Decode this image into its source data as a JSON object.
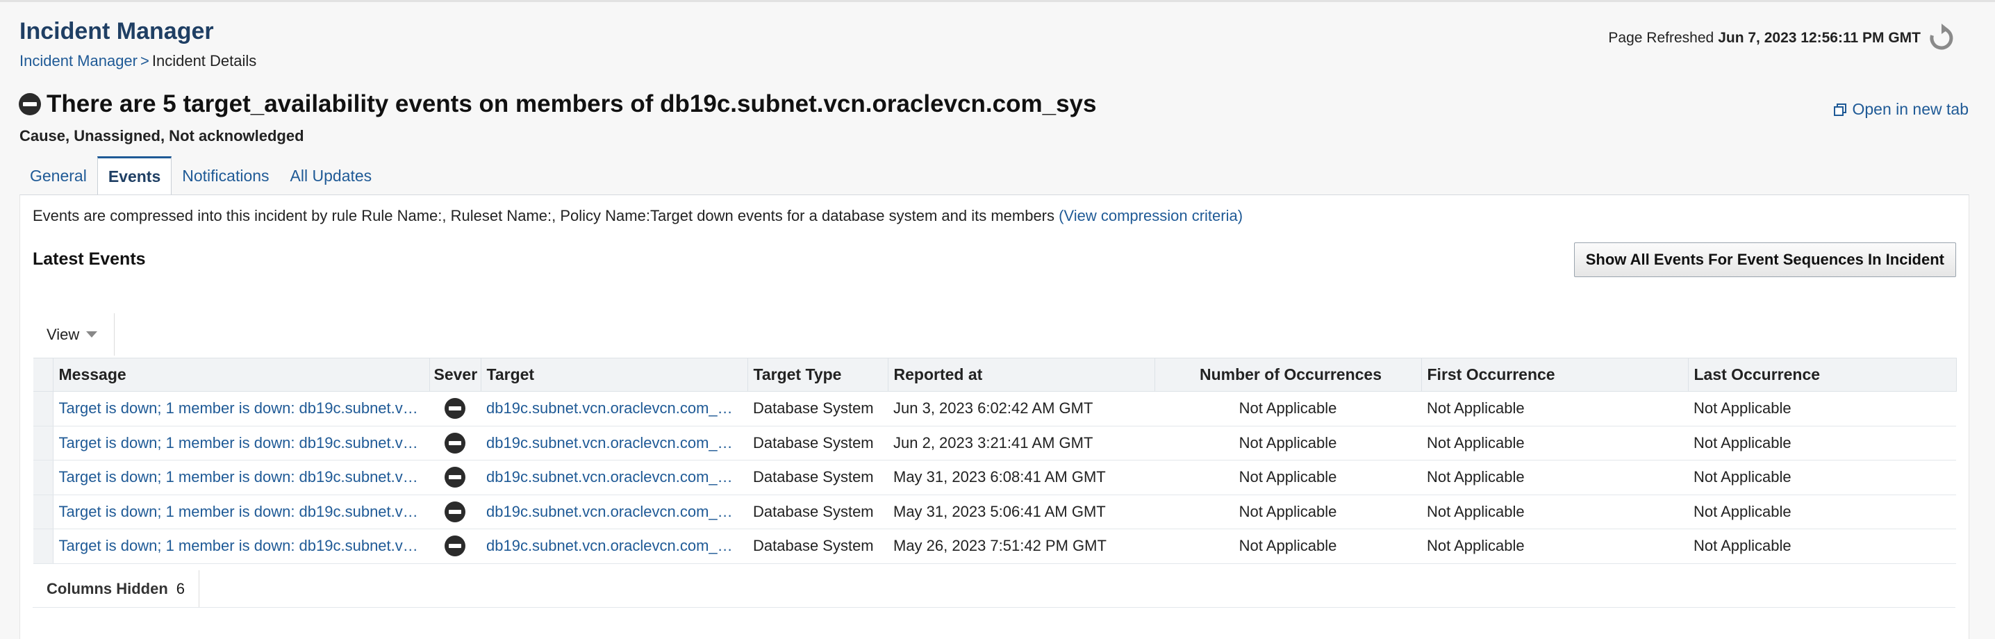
{
  "header": {
    "title": "Incident Manager",
    "breadcrumb": {
      "link": "Incident Manager",
      "separator": ">",
      "current": "Incident Details"
    },
    "refresh_label": "Page Refreshed",
    "refresh_time": "Jun 7, 2023 12:56:11 PM GMT"
  },
  "incident": {
    "title": "There are 5 target_availability events on members of db19c.subnet.vcn.oraclevcn.com_sys",
    "status": "Cause, Unassigned, Not acknowledged",
    "open_new_tab": "Open in new tab"
  },
  "tabs": [
    {
      "label": "General"
    },
    {
      "label": "Events",
      "active": true
    },
    {
      "label": "Notifications"
    },
    {
      "label": "All Updates"
    }
  ],
  "events_panel": {
    "compression_text": "Events are compressed into this incident by rule Rule Name:, Ruleset Name:, Policy Name:Target down events for a database system and its members",
    "compression_link": "(View compression criteria)",
    "latest_heading": "Latest Events",
    "show_all_button": "Show All Events For Event Sequences In Incident",
    "view_label": "View",
    "columns": [
      "Message",
      "Sever",
      "Target",
      "Target Type",
      "Reported at",
      "Number of Occurrences",
      "First Occurrence",
      "Last Occurrence"
    ],
    "rows": [
      {
        "message": "Target is down; 1 member is down: db19c.subnet.v…",
        "target": "db19c.subnet.vcn.oraclevcn.com_…",
        "target_type": "Database System",
        "reported_at": "Jun 3, 2023 6:02:42 AM GMT",
        "occurrences": "Not Applicable",
        "first": "Not Applicable",
        "last": "Not Applicable"
      },
      {
        "message": "Target is down; 1 member is down: db19c.subnet.v…",
        "target": "db19c.subnet.vcn.oraclevcn.com_…",
        "target_type": "Database System",
        "reported_at": "Jun 2, 2023 3:21:41 AM GMT",
        "occurrences": "Not Applicable",
        "first": "Not Applicable",
        "last": "Not Applicable"
      },
      {
        "message": "Target is down; 1 member is down: db19c.subnet.v…",
        "target": "db19c.subnet.vcn.oraclevcn.com_…",
        "target_type": "Database System",
        "reported_at": "May 31, 2023 6:08:41 AM GMT",
        "occurrences": "Not Applicable",
        "first": "Not Applicable",
        "last": "Not Applicable"
      },
      {
        "message": "Target is down; 1 member is down: db19c.subnet.v…",
        "target": "db19c.subnet.vcn.oraclevcn.com_…",
        "target_type": "Database System",
        "reported_at": "May 31, 2023 5:06:41 AM GMT",
        "occurrences": "Not Applicable",
        "first": "Not Applicable",
        "last": "Not Applicable"
      },
      {
        "message": "Target is down; 1 member is down: db19c.subnet.v…",
        "target": "db19c.subnet.vcn.oraclevcn.com_…",
        "target_type": "Database System",
        "reported_at": "May 26, 2023 7:51:42 PM GMT",
        "occurrences": "Not Applicable",
        "first": "Not Applicable",
        "last": "Not Applicable"
      }
    ],
    "columns_hidden_label": "Columns Hidden",
    "columns_hidden_count": "6"
  },
  "icons": {
    "refresh": "refresh-icon",
    "severity": "fatal-severity-icon",
    "open_tab": "open-new-tab-icon",
    "view_menu": "dropdown-arrow-icon"
  }
}
